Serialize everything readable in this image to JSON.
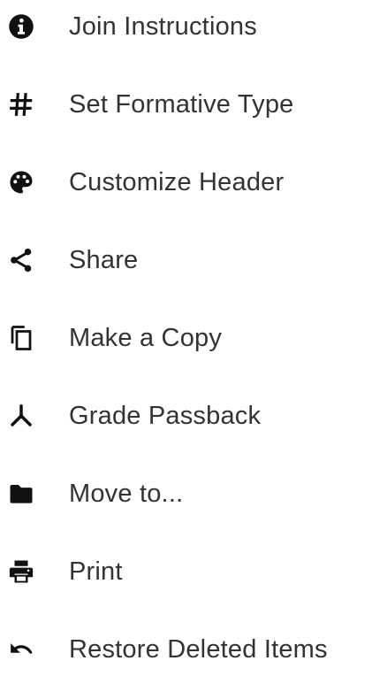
{
  "menu": {
    "items": [
      {
        "label": "Join Instructions",
        "icon": "info-circle-icon"
      },
      {
        "label": "Set Formative Type",
        "icon": "hash-icon"
      },
      {
        "label": "Customize Header",
        "icon": "palette-icon"
      },
      {
        "label": "Share",
        "icon": "share-icon"
      },
      {
        "label": "Make a Copy",
        "icon": "copy-icon"
      },
      {
        "label": "Grade Passback",
        "icon": "merge-icon"
      },
      {
        "label": "Move to...",
        "icon": "folder-icon"
      },
      {
        "label": "Print",
        "icon": "printer-icon"
      },
      {
        "label": "Restore Deleted Items",
        "icon": "undo-icon"
      }
    ]
  },
  "colors": {
    "text": "#333333",
    "icon": "#111111",
    "background": "#ffffff"
  }
}
